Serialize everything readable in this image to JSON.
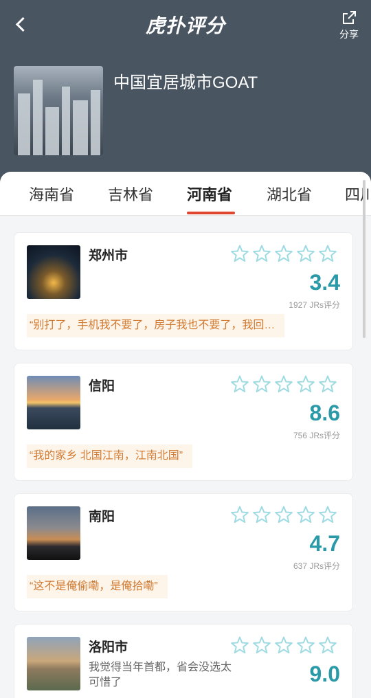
{
  "header": {
    "app_title": "虎扑评分",
    "share_label": "分享",
    "list_title": "中国宜居城市GOAT"
  },
  "tabs": [
    {
      "label": "海南省"
    },
    {
      "label": "吉林省"
    },
    {
      "label": "河南省"
    },
    {
      "label": "湖北省"
    },
    {
      "label": "四川"
    }
  ],
  "active_tab": "河南省",
  "cities": [
    {
      "name": "郑州市",
      "score": "3.4",
      "count": "1927 JRs评分",
      "quote": "“别打了，手机我不要了，房子我也不要了，我回…"
    },
    {
      "name": "信阳",
      "score": "8.6",
      "count": "756 JRs评分",
      "quote": "“我的家乡 北国江南，江南北国”"
    },
    {
      "name": "南阳",
      "score": "4.7",
      "count": "637 JRs评分",
      "quote": "“这不是俺偷嘞，是俺拾嘞”"
    },
    {
      "name": "洛阳市",
      "score": "9.0",
      "subtext": "我觉得当年首都，省会没选太可惜了"
    }
  ],
  "colors": {
    "header_bg": "#4a5562",
    "accent_red": "#e0452f",
    "score_teal": "#2a9aa8",
    "quote_text": "#d27b33"
  }
}
